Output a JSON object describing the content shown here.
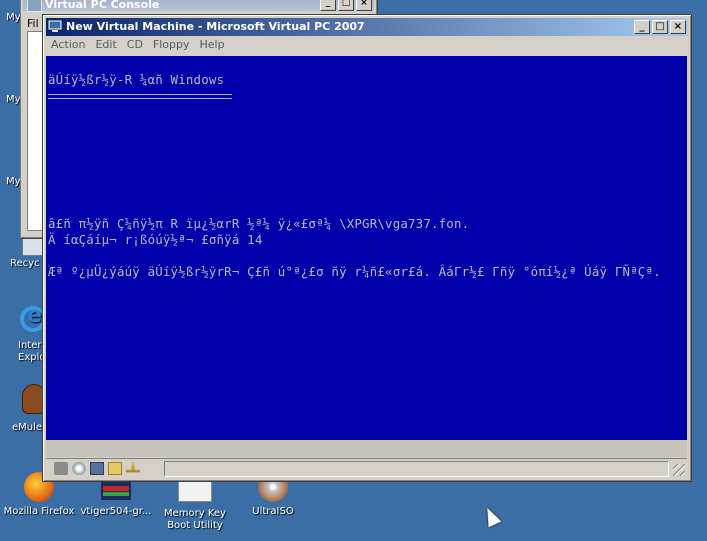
{
  "desktop": {
    "left_labels": [
      "My",
      "My",
      "My",
      "Recyc",
      "Inter",
      "Explo",
      "eMule"
    ],
    "bottom_icons": [
      {
        "icon": "firefox-icon",
        "label": "Mozilla Firefox"
      },
      {
        "icon": "vtiger-icon",
        "label": "vtiger504-gr..."
      },
      {
        "icon": "memory-key-icon",
        "label": "Memory Key",
        "label2": "Boot Utility"
      },
      {
        "icon": "ultraiso-icon",
        "label": "UltraISO"
      }
    ]
  },
  "console_window": {
    "title": "Virtual PC Console",
    "menu_first": "Fil",
    "controls": [
      "_",
      "□",
      "×"
    ]
  },
  "vm_window": {
    "title": "New Virtual Machine - Microsoft Virtual PC 2007",
    "controls": [
      "_",
      "□",
      "×"
    ],
    "menu": [
      "Action",
      "Edit",
      "CD",
      "Floppy",
      "Help"
    ],
    "screen": {
      "bg_color": "#0000aa",
      "text_color": "#b8b8c8",
      "heading": "äÚíÿ½ßr½ÿ-R ¼αñ Windows",
      "line1": "â£ñ π½ÿñ Ç¼ñÿ½π R ïµ¿½αrR ½ª¼ ÿ¿«£σª¼ \\XPGR\\vga737.fon.",
      "line2": "Ä íαÇáíµ¬ r¡ßóúÿ½ª¬ £σñÿá 14",
      "line3": "Æª º¿µÜ¿ýáúÿ äÚíÿ½ßr½ÿrR¬ Ç£ñ ú°ª¿£σ ñÿ r¼ñ£«σr£á. ÂáΓr½£ Γñÿ °óπí½¿ª Úáÿ ΓÑªÇª."
    },
    "status_icons": [
      "network-icon",
      "cd-icon",
      "floppy-icon",
      "shared-folder-icon",
      "usb-icon"
    ]
  },
  "colors": {
    "desktop": "#3a6ea5",
    "titlebar_active_start": "#0a246a",
    "titlebar_active_end": "#a6caf0",
    "window_face": "#d4d0c8"
  }
}
